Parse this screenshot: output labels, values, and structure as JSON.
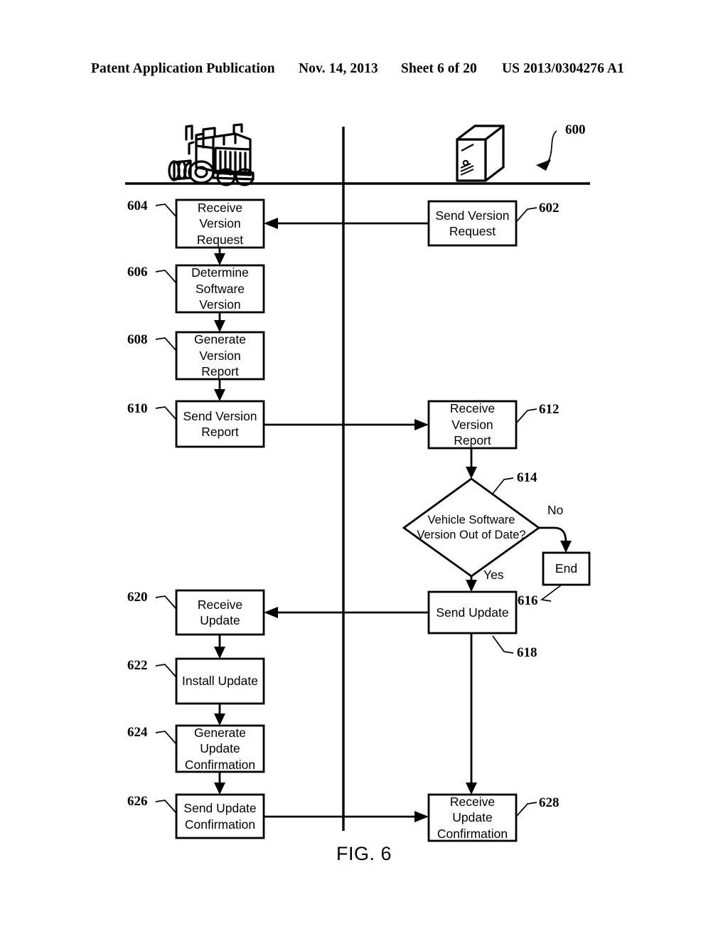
{
  "header": {
    "publication": "Patent Application Publication",
    "date": "Nov. 14, 2013",
    "sheet": "Sheet 6 of 20",
    "patent_number": "US 2013/0304276 A1"
  },
  "figure": {
    "caption": "FIG. 6",
    "diagram_ref": "600"
  },
  "lanes": {
    "left": {
      "actor_icon": "semi-truck-icon",
      "actor_label": ""
    },
    "right": {
      "actor_icon": "server-tower-icon",
      "actor_label": ""
    }
  },
  "nodes": [
    {
      "id": "602",
      "ref": "602",
      "label": "Send Version\nRequest",
      "shape": "rect",
      "lane": "right"
    },
    {
      "id": "604",
      "ref": "604",
      "label": "Receive\nVersion\nRequest",
      "shape": "rect",
      "lane": "left"
    },
    {
      "id": "606",
      "ref": "606",
      "label": "Determine\nSoftware\nVersion",
      "shape": "rect",
      "lane": "left"
    },
    {
      "id": "608",
      "ref": "608",
      "label": "Generate\nVersion\nReport",
      "shape": "rect",
      "lane": "left"
    },
    {
      "id": "610",
      "ref": "610",
      "label": "Send Version\nReport",
      "shape": "rect",
      "lane": "left"
    },
    {
      "id": "612",
      "ref": "612",
      "label": "Receive\nVersion\nReport",
      "shape": "rect",
      "lane": "right"
    },
    {
      "id": "614",
      "ref": "614",
      "label": "Vehicle Software\nVersion Out of Date?",
      "shape": "diamond",
      "lane": "right"
    },
    {
      "id": "616",
      "ref": "616",
      "label": "End",
      "shape": "rect",
      "lane": "right"
    },
    {
      "id": "618",
      "ref": "618",
      "label": "Send Update",
      "shape": "rect",
      "lane": "right"
    },
    {
      "id": "620",
      "ref": "620",
      "label": "Receive\nUpdate",
      "shape": "rect",
      "lane": "left"
    },
    {
      "id": "622",
      "ref": "622",
      "label": "Install Update",
      "shape": "rect",
      "lane": "left"
    },
    {
      "id": "624",
      "ref": "624",
      "label": "Generate\nUpdate\nConfirmation",
      "shape": "rect",
      "lane": "left"
    },
    {
      "id": "626",
      "ref": "626",
      "label": "Send Update\nConfirmation",
      "shape": "rect",
      "lane": "left"
    },
    {
      "id": "628",
      "ref": "628",
      "label": "Receive\nUpdate\nConfirmation",
      "shape": "rect",
      "lane": "right"
    }
  ],
  "branch_labels": {
    "no": "No",
    "yes": "Yes"
  },
  "colors": {
    "ink": "#000000",
    "paper": "#ffffff"
  }
}
